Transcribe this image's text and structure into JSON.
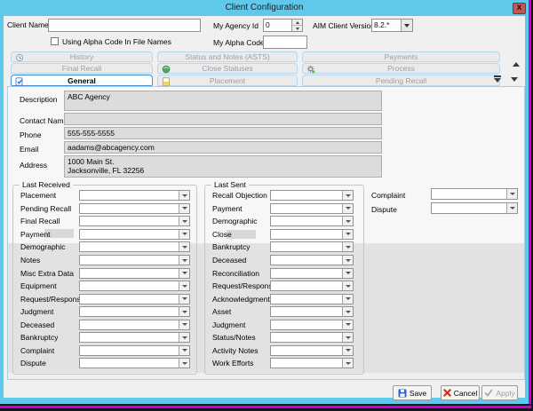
{
  "window": {
    "title": "Client Configuration"
  },
  "colors": {
    "titlebar": "#5fc9ec",
    "outer_accent": "#ce00ce",
    "close_button": "#bf5a52",
    "selected_tab_border": "#3c8fd4",
    "save_icon_blue": "#2e62d9",
    "cancel_icon_red": "#c23225",
    "apply_icon_gray": "#a9a9a9"
  },
  "header": {
    "client_name": {
      "label": "Client Name",
      "value": ""
    },
    "alpha_checkbox": {
      "label": "Using Alpha Code In File Names",
      "checked": false
    },
    "my_agency_id": {
      "label": "My Agency Id",
      "value": "0"
    },
    "my_alpha_code": {
      "label": "My Alpha Code",
      "value": ""
    },
    "aim_client_version": {
      "label": "AIM Client Version",
      "value": "8.2.*"
    }
  },
  "tabs": {
    "history": "History",
    "status_and_notes": "Status and Notes (ASTS)",
    "payments": "Payments",
    "final_recall": "Final Recall",
    "close_statuses": "Close Statuses",
    "process": "Process",
    "general": "General",
    "placement": "Placement",
    "pending_recall": "Pending Recall",
    "selected": "General"
  },
  "general_tab": {
    "description": {
      "label": "Description",
      "value": "ABC Agency"
    },
    "contact_name": {
      "label": "Contact Name",
      "value": ""
    },
    "phone": {
      "label": "Phone",
      "value": "555-555-5555"
    },
    "email": {
      "label": "Email",
      "value": "aadams@abcagency.com"
    },
    "address": {
      "label": "Address",
      "value": "1000 Main St.\nJacksonville, FL 32256"
    }
  },
  "last_received": {
    "title": "Last Received",
    "items": [
      "Placement",
      "Pending Recall",
      "Final Recall",
      "Payment",
      "Demographic",
      "Notes",
      "Misc Extra Data",
      "Equipment",
      "Request/Response",
      "Judgment",
      "Deceased",
      "Bankruptcy",
      "Complaint",
      "Dispute"
    ]
  },
  "last_sent": {
    "title": "Last Sent",
    "items": [
      "Recall Objection",
      "Payment",
      "Demographic",
      "Close",
      "Bankruptcy",
      "Deceased",
      "Reconciliation",
      "Request/Response",
      "Acknowledgment",
      "Asset",
      "Judgment",
      "Status/Notes",
      "Activity Notes",
      "Work Efforts"
    ]
  },
  "right_fields": {
    "items": [
      "Complaint",
      "Dispute"
    ]
  },
  "footer": {
    "save_label": "Save",
    "cancel_label": "Cancel",
    "apply_label": "Apply"
  }
}
